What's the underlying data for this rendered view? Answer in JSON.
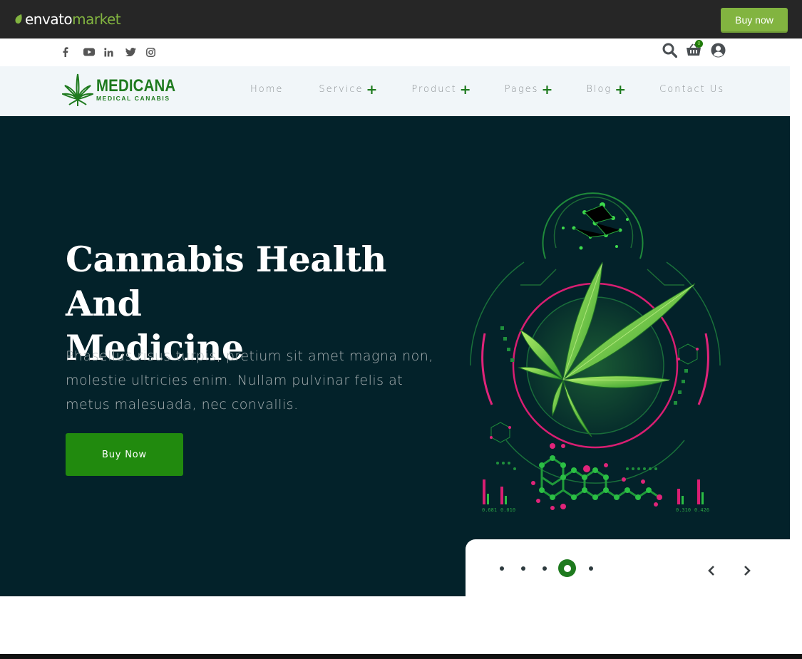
{
  "envato": {
    "brand": "envato",
    "market": "market",
    "buy_label": "Buy now",
    "accent": "#82b440"
  },
  "topbar": {
    "social_icons": [
      "facebook-icon",
      "youtube-icon",
      "linkedin-icon",
      "twitter-icon",
      "instagram-icon"
    ],
    "cart_count": "0"
  },
  "logo": {
    "title": "MEDICANA",
    "subtitle": "MEDICAL CANABIS"
  },
  "nav": {
    "items": [
      {
        "label": "Home",
        "has_submenu": false
      },
      {
        "label": "Service",
        "has_submenu": true
      },
      {
        "label": "Product",
        "has_submenu": true
      },
      {
        "label": "Pages",
        "has_submenu": true
      },
      {
        "label": "Blog",
        "has_submenu": true
      },
      {
        "label": "Contact Us",
        "has_submenu": false
      }
    ],
    "plus": "+"
  },
  "hero": {
    "title_line1": "Cannabis Health And",
    "title_line2": "Medicine",
    "text": "Phasellus risus turpis, pretium sit amet magna non, molestie ultricies enim. Nullam pulvinar felis at metus malesuada, nec convallis.",
    "button_label": "Buy Now",
    "background": "#03222a",
    "accent": "#218a0e"
  },
  "slider": {
    "total_slides": 5,
    "active_slide": 4
  },
  "art_labels": [
    "0.681",
    "0.010",
    "0.310",
    "0.426"
  ]
}
